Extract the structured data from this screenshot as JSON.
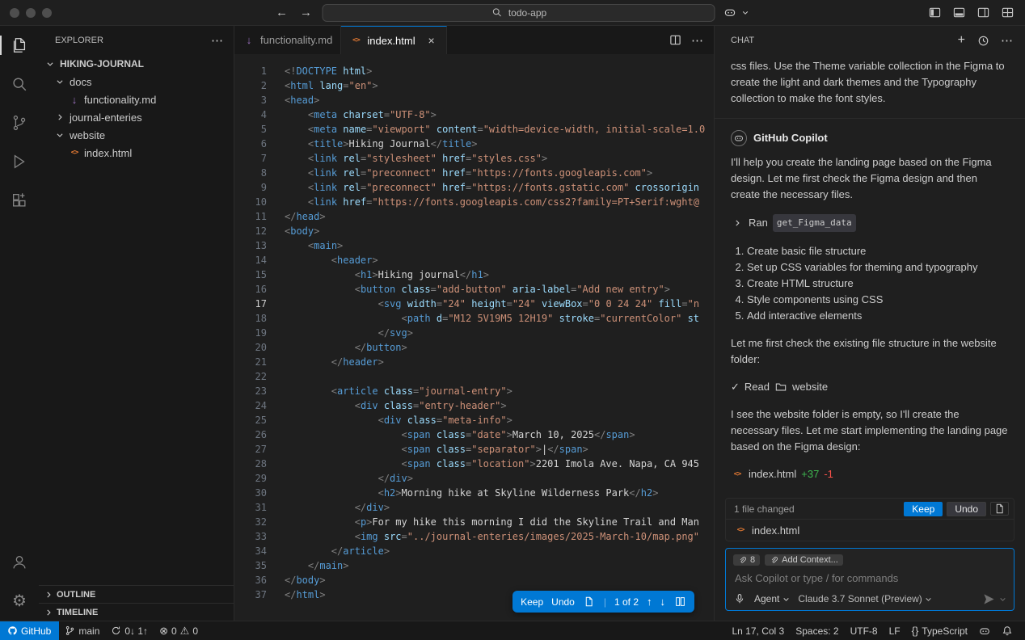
{
  "window": {
    "search_query": "todo-app"
  },
  "explorer": {
    "title": "EXPLORER",
    "root": "HIKING-JOURNAL",
    "items": [
      {
        "label": "docs"
      },
      {
        "label": "functionality.md"
      },
      {
        "label": "journal-enteries"
      },
      {
        "label": "website"
      },
      {
        "label": "index.html"
      }
    ],
    "sections": [
      {
        "label": "OUTLINE"
      },
      {
        "label": "TIMELINE"
      }
    ]
  },
  "editor": {
    "tabs": [
      {
        "label": "functionality.md"
      },
      {
        "label": "index.html"
      }
    ],
    "active_line": 17,
    "widget": {
      "keep": "Keep",
      "undo": "Undo",
      "position": "1 of 2"
    },
    "code": [
      [
        [
          "g",
          "<!"
        ],
        [
          "t",
          "DOCTYPE"
        ],
        [
          "a",
          " html"
        ],
        [
          "g",
          ">"
        ]
      ],
      [
        [
          "g",
          "<"
        ],
        [
          "t",
          "html"
        ],
        [
          "a",
          " lang"
        ],
        [
          "g",
          "="
        ],
        [
          "s",
          "\"en\""
        ],
        [
          "g",
          ">"
        ]
      ],
      [
        [
          "g",
          "<"
        ],
        [
          "t",
          "head"
        ],
        [
          "g",
          ">"
        ]
      ],
      [
        [
          "x",
          "    "
        ],
        [
          "g",
          "<"
        ],
        [
          "t",
          "meta"
        ],
        [
          "a",
          " charset"
        ],
        [
          "g",
          "="
        ],
        [
          "s",
          "\"UTF-8\""
        ],
        [
          "g",
          ">"
        ]
      ],
      [
        [
          "x",
          "    "
        ],
        [
          "g",
          "<"
        ],
        [
          "t",
          "meta"
        ],
        [
          "a",
          " name"
        ],
        [
          "g",
          "="
        ],
        [
          "s",
          "\"viewport\""
        ],
        [
          "a",
          " content"
        ],
        [
          "g",
          "="
        ],
        [
          "s",
          "\"width=device-width, initial-scale=1.0"
        ]
      ],
      [
        [
          "x",
          "    "
        ],
        [
          "g",
          "<"
        ],
        [
          "t",
          "title"
        ],
        [
          "g",
          ">"
        ],
        [
          "x",
          "Hiking Journal"
        ],
        [
          "g",
          "</"
        ],
        [
          "t",
          "title"
        ],
        [
          "g",
          ">"
        ]
      ],
      [
        [
          "x",
          "    "
        ],
        [
          "g",
          "<"
        ],
        [
          "t",
          "link"
        ],
        [
          "a",
          " rel"
        ],
        [
          "g",
          "="
        ],
        [
          "s",
          "\"stylesheet\""
        ],
        [
          "a",
          " href"
        ],
        [
          "g",
          "="
        ],
        [
          "s",
          "\"styles.css\""
        ],
        [
          "g",
          ">"
        ]
      ],
      [
        [
          "x",
          "    "
        ],
        [
          "g",
          "<"
        ],
        [
          "t",
          "link"
        ],
        [
          "a",
          " rel"
        ],
        [
          "g",
          "="
        ],
        [
          "s",
          "\"preconnect\""
        ],
        [
          "a",
          " href"
        ],
        [
          "g",
          "="
        ],
        [
          "s",
          "\"https://fonts.googleapis.com\""
        ],
        [
          "g",
          ">"
        ]
      ],
      [
        [
          "x",
          "    "
        ],
        [
          "g",
          "<"
        ],
        [
          "t",
          "link"
        ],
        [
          "a",
          " rel"
        ],
        [
          "g",
          "="
        ],
        [
          "s",
          "\"preconnect\""
        ],
        [
          "a",
          " href"
        ],
        [
          "g",
          "="
        ],
        [
          "s",
          "\"https://fonts.gstatic.com\""
        ],
        [
          "a",
          " crossorigin"
        ]
      ],
      [
        [
          "x",
          "    "
        ],
        [
          "g",
          "<"
        ],
        [
          "t",
          "link"
        ],
        [
          "a",
          " href"
        ],
        [
          "g",
          "="
        ],
        [
          "s",
          "\"https://fonts.googleapis.com/css2?family=PT+Serif:wght@"
        ]
      ],
      [
        [
          "g",
          "</"
        ],
        [
          "t",
          "head"
        ],
        [
          "g",
          ">"
        ]
      ],
      [
        [
          "g",
          "<"
        ],
        [
          "t",
          "body"
        ],
        [
          "g",
          ">"
        ]
      ],
      [
        [
          "x",
          "    "
        ],
        [
          "g",
          "<"
        ],
        [
          "t",
          "main"
        ],
        [
          "g",
          ">"
        ]
      ],
      [
        [
          "x",
          "        "
        ],
        [
          "g",
          "<"
        ],
        [
          "t",
          "header"
        ],
        [
          "g",
          ">"
        ]
      ],
      [
        [
          "x",
          "            "
        ],
        [
          "g",
          "<"
        ],
        [
          "t",
          "h1"
        ],
        [
          "g",
          ">"
        ],
        [
          "x",
          "Hiking journal"
        ],
        [
          "g",
          "</"
        ],
        [
          "t",
          "h1"
        ],
        [
          "g",
          ">"
        ]
      ],
      [
        [
          "x",
          "            "
        ],
        [
          "g",
          "<"
        ],
        [
          "t",
          "button"
        ],
        [
          "a",
          " class"
        ],
        [
          "g",
          "="
        ],
        [
          "s",
          "\"add-button\""
        ],
        [
          "a",
          " aria-label"
        ],
        [
          "g",
          "="
        ],
        [
          "s",
          "\"Add new entry\""
        ],
        [
          "g",
          ">"
        ]
      ],
      [
        [
          "x",
          "                "
        ],
        [
          "g",
          "<"
        ],
        [
          "t",
          "svg"
        ],
        [
          "a",
          " width"
        ],
        [
          "g",
          "="
        ],
        [
          "s",
          "\"24\""
        ],
        [
          "a",
          " height"
        ],
        [
          "g",
          "="
        ],
        [
          "s",
          "\"24\""
        ],
        [
          "a",
          " viewBox"
        ],
        [
          "g",
          "="
        ],
        [
          "s",
          "\"0 0 24 24\""
        ],
        [
          "a",
          " fill"
        ],
        [
          "g",
          "="
        ],
        [
          "s",
          "\"n"
        ]
      ],
      [
        [
          "x",
          "                    "
        ],
        [
          "g",
          "<"
        ],
        [
          "t",
          "path"
        ],
        [
          "a",
          " d"
        ],
        [
          "g",
          "="
        ],
        [
          "s",
          "\"M12 5V19M5 12H19\""
        ],
        [
          "a",
          " stroke"
        ],
        [
          "g",
          "="
        ],
        [
          "s",
          "\"currentColor\""
        ],
        [
          "a",
          " st"
        ]
      ],
      [
        [
          "x",
          "                "
        ],
        [
          "g",
          "</"
        ],
        [
          "t",
          "svg"
        ],
        [
          "g",
          ">"
        ]
      ],
      [
        [
          "x",
          "            "
        ],
        [
          "g",
          "</"
        ],
        [
          "t",
          "button"
        ],
        [
          "g",
          ">"
        ]
      ],
      [
        [
          "x",
          "        "
        ],
        [
          "g",
          "</"
        ],
        [
          "t",
          "header"
        ],
        [
          "g",
          ">"
        ]
      ],
      [],
      [
        [
          "x",
          "        "
        ],
        [
          "g",
          "<"
        ],
        [
          "t",
          "article"
        ],
        [
          "a",
          " class"
        ],
        [
          "g",
          "="
        ],
        [
          "s",
          "\"journal-entry\""
        ],
        [
          "g",
          ">"
        ]
      ],
      [
        [
          "x",
          "            "
        ],
        [
          "g",
          "<"
        ],
        [
          "t",
          "div"
        ],
        [
          "a",
          " class"
        ],
        [
          "g",
          "="
        ],
        [
          "s",
          "\"entry-header\""
        ],
        [
          "g",
          ">"
        ]
      ],
      [
        [
          "x",
          "                "
        ],
        [
          "g",
          "<"
        ],
        [
          "t",
          "div"
        ],
        [
          "a",
          " class"
        ],
        [
          "g",
          "="
        ],
        [
          "s",
          "\"meta-info\""
        ],
        [
          "g",
          ">"
        ]
      ],
      [
        [
          "x",
          "                    "
        ],
        [
          "g",
          "<"
        ],
        [
          "t",
          "span"
        ],
        [
          "a",
          " class"
        ],
        [
          "g",
          "="
        ],
        [
          "s",
          "\"date\""
        ],
        [
          "g",
          ">"
        ],
        [
          "x",
          "March 10, 2025"
        ],
        [
          "g",
          "</"
        ],
        [
          "t",
          "span"
        ],
        [
          "g",
          ">"
        ]
      ],
      [
        [
          "x",
          "                    "
        ],
        [
          "g",
          "<"
        ],
        [
          "t",
          "span"
        ],
        [
          "a",
          " class"
        ],
        [
          "g",
          "="
        ],
        [
          "s",
          "\"separator\""
        ],
        [
          "g",
          ">"
        ],
        [
          "x",
          "|"
        ],
        [
          "g",
          "</"
        ],
        [
          "t",
          "span"
        ],
        [
          "g",
          ">"
        ]
      ],
      [
        [
          "x",
          "                    "
        ],
        [
          "g",
          "<"
        ],
        [
          "t",
          "span"
        ],
        [
          "a",
          " class"
        ],
        [
          "g",
          "="
        ],
        [
          "s",
          "\"location\""
        ],
        [
          "g",
          ">"
        ],
        [
          "x",
          "2201 Imola Ave. Napa, CA 945"
        ]
      ],
      [
        [
          "x",
          "                "
        ],
        [
          "g",
          "</"
        ],
        [
          "t",
          "div"
        ],
        [
          "g",
          ">"
        ]
      ],
      [
        [
          "x",
          "                "
        ],
        [
          "g",
          "<"
        ],
        [
          "t",
          "h2"
        ],
        [
          "g",
          ">"
        ],
        [
          "x",
          "Morning hike at Skyline Wilderness Park"
        ],
        [
          "g",
          "</"
        ],
        [
          "t",
          "h2"
        ],
        [
          "g",
          ">"
        ]
      ],
      [
        [
          "x",
          "            "
        ],
        [
          "g",
          "</"
        ],
        [
          "t",
          "div"
        ],
        [
          "g",
          ">"
        ]
      ],
      [
        [
          "x",
          "            "
        ],
        [
          "g",
          "<"
        ],
        [
          "t",
          "p"
        ],
        [
          "g",
          ">"
        ],
        [
          "x",
          "For my hike this morning I did the Skyline Trail and Man"
        ]
      ],
      [
        [
          "x",
          "            "
        ],
        [
          "g",
          "<"
        ],
        [
          "t",
          "img"
        ],
        [
          "a",
          " src"
        ],
        [
          "g",
          "="
        ],
        [
          "s",
          "\"../journal-enteries/images/2025-March-10/map.png\""
        ]
      ],
      [
        [
          "x",
          "        "
        ],
        [
          "g",
          "</"
        ],
        [
          "t",
          "article"
        ],
        [
          "g",
          ">"
        ]
      ],
      [
        [
          "x",
          "    "
        ],
        [
          "g",
          "</"
        ],
        [
          "t",
          "main"
        ],
        [
          "g",
          ">"
        ]
      ],
      [
        [
          "g",
          "</"
        ],
        [
          "t",
          "body"
        ],
        [
          "g",
          ">"
        ]
      ],
      [
        [
          "g",
          "</"
        ],
        [
          "t",
          "html"
        ],
        [
          "g",
          ">"
        ]
      ]
    ]
  },
  "chat": {
    "title": "CHAT",
    "scrolled_text": "css files. Use the Theme variable collection in the Figma to create the light and dark themes and the Typography collection to make the font styles.",
    "assistant_name": "GitHub Copilot",
    "intro": "I'll help you create the landing page based on the Figma design. Let me first check the Figma design and then create the necessary files.",
    "tool_run_prefix": "Ran",
    "tool_run_name": "get_Figma_data",
    "plan": [
      "Create basic file structure",
      "Set up CSS variables for theming and typography",
      "Create HTML structure",
      "Style components using CSS",
      "Add interactive elements"
    ],
    "check_text": "Let me first check the existing file structure in the website folder:",
    "tool_read_prefix": "Read",
    "tool_read_target": "website",
    "empty_text": "I see the website folder is empty, so I'll create the necessary files. Let me start implementing the landing page based on the Figma design:",
    "file_edit": {
      "file": "index.html",
      "added": "+37",
      "removed": "-1"
    },
    "changes": {
      "label": "1 file changed",
      "keep": "Keep",
      "undo": "Undo",
      "file": "index.html"
    },
    "input": {
      "attach_count": "8",
      "add_context": "Add Context...",
      "placeholder": "Ask Copilot or type / for commands",
      "mode": "Agent",
      "model": "Claude 3.7 Sonnet (Preview)"
    }
  },
  "statusbar": {
    "remote": "GitHub",
    "branch": "main",
    "sync": "0↓ 1↑",
    "errors": "0",
    "warnings": "0",
    "line_col": "Ln 17, Col 3",
    "indent": "Spaces: 2",
    "encoding": "UTF-8",
    "eol": "LF",
    "language": "TypeScript"
  },
  "colors": {
    "accent": "#0078d4",
    "added": "#3fb950",
    "removed": "#f85149",
    "markdown_icon": "#a074c4",
    "html_icon": "#e37933",
    "tag": "#569cd6",
    "attribute": "#9cdcfe",
    "string": "#ce9178"
  }
}
